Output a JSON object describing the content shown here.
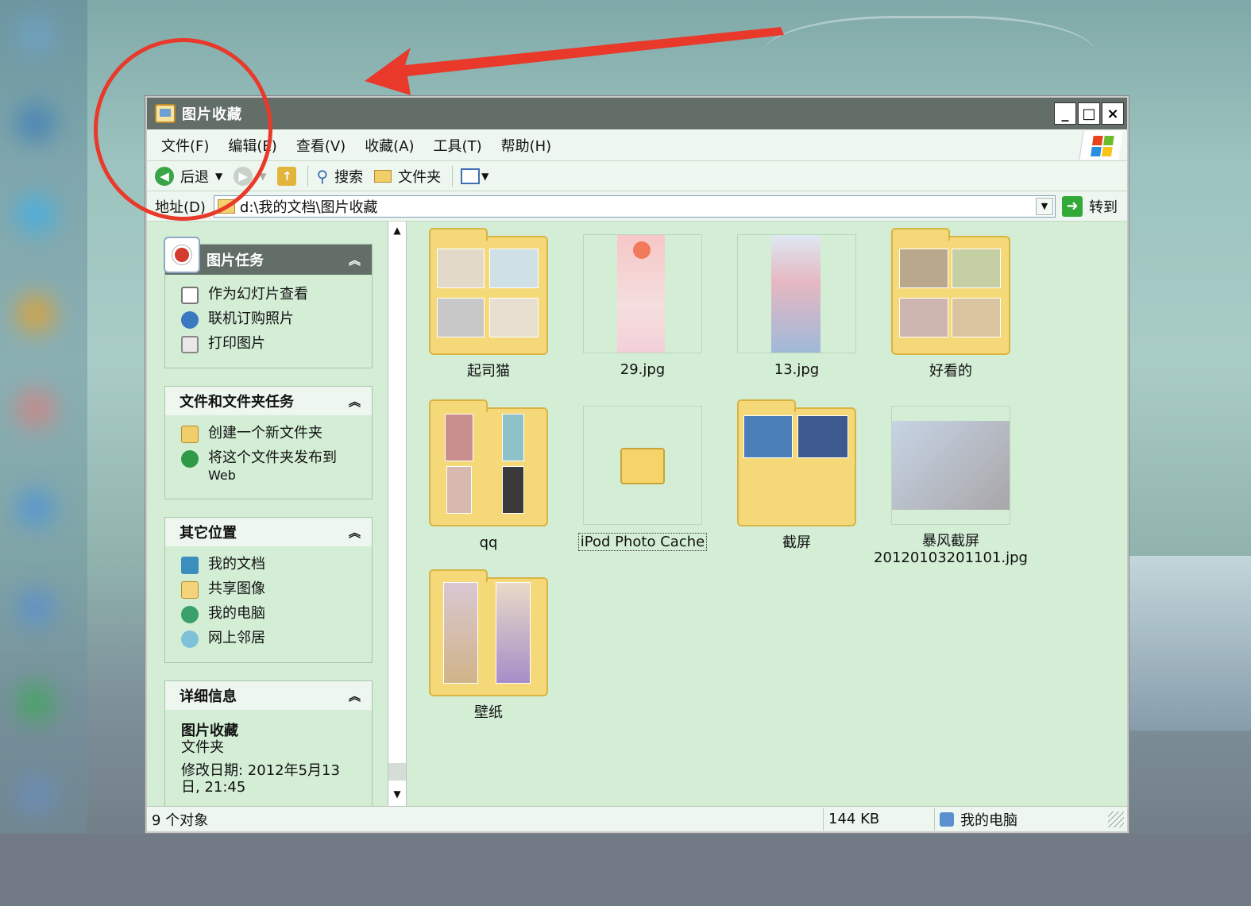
{
  "window": {
    "title": "图片收藏",
    "minimize": "_",
    "maximize": "□",
    "close": "×"
  },
  "menubar": {
    "items": [
      "文件(F)",
      "编辑(E)",
      "查看(V)",
      "收藏(A)",
      "工具(T)",
      "帮助(H)"
    ]
  },
  "toolbar": {
    "back_label": "后退",
    "search_label": "搜索",
    "folders_label": "文件夹"
  },
  "address": {
    "label": "地址(D)",
    "value": "d:\\我的文档\\图片收藏",
    "go_label": "转到"
  },
  "taskpane": {
    "picture_tasks": {
      "title": "图片任务",
      "items": [
        "作为幻灯片查看",
        "联机订购照片",
        "打印图片"
      ]
    },
    "file_tasks": {
      "title": "文件和文件夹任务",
      "items": [
        "创建一个新文件夹",
        "将这个文件夹发布到",
        "Web"
      ]
    },
    "other_places": {
      "title": "其它位置",
      "items": [
        "我的文档",
        "共享图像",
        "我的电脑",
        "网上邻居"
      ]
    },
    "details": {
      "title": "详细信息",
      "name": "图片收藏",
      "type": "文件夹",
      "modified": "修改日期: 2012年5月13",
      "modified_2": "日, 21:45"
    }
  },
  "files": [
    {
      "name": "起司猫",
      "kind": "folder"
    },
    {
      "name": "29.jpg",
      "kind": "image"
    },
    {
      "name": "13.jpg",
      "kind": "image"
    },
    {
      "name": "好看的",
      "kind": "folder"
    },
    {
      "name": "qq",
      "kind": "folder"
    },
    {
      "name": "iPod Photo Cache",
      "kind": "folder-empty",
      "selected": true
    },
    {
      "name": "截屏",
      "kind": "folder"
    },
    {
      "name": "暴风截屏",
      "name_2": "20120103201101.jpg",
      "kind": "image"
    },
    {
      "name": "壁纸",
      "kind": "folder"
    }
  ],
  "status": {
    "count": "9 个对象",
    "size": "144 KB",
    "location": "我的电脑"
  },
  "colors": {
    "annotation": "#e8392a",
    "window_bg": "#d4eed6",
    "titlebar": "#626e67"
  }
}
